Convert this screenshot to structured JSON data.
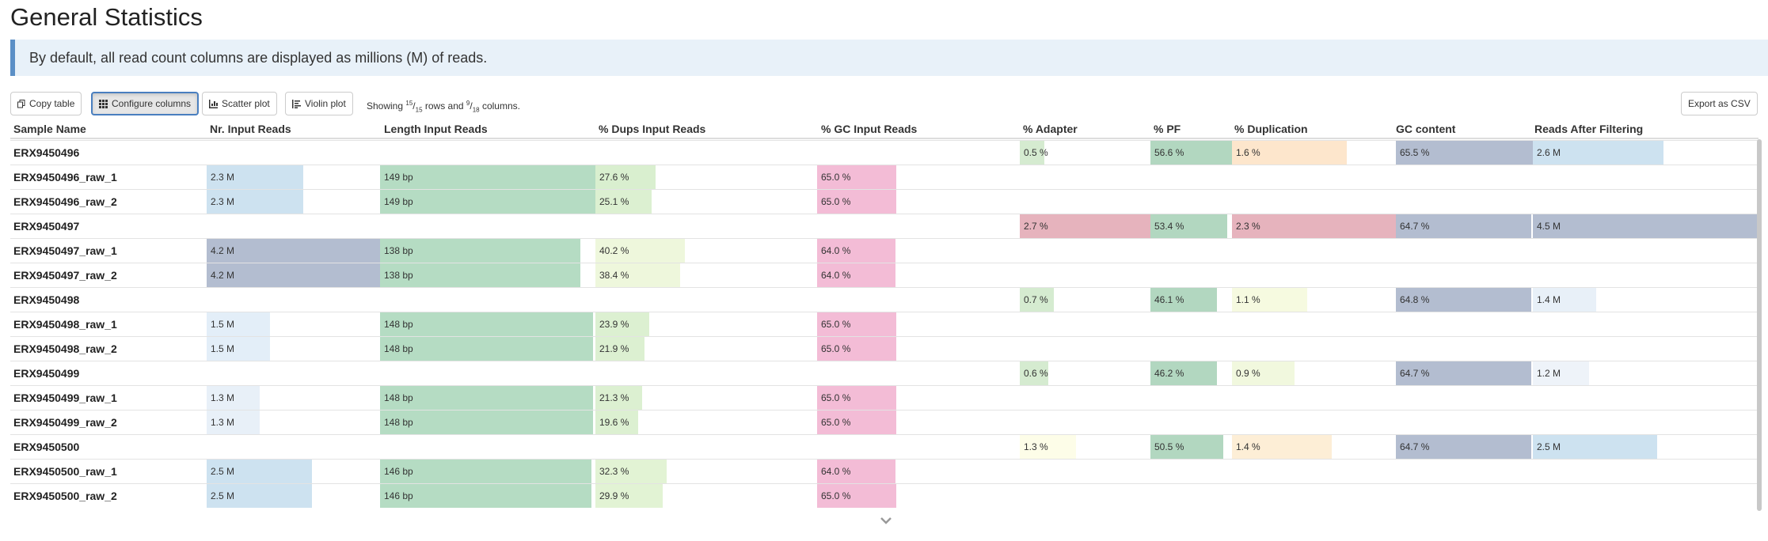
{
  "page": {
    "title": "General Statistics"
  },
  "banner": {
    "text": "By default, all read count columns are displayed as millions (M) of reads."
  },
  "toolbar": {
    "copy_label": "Copy table",
    "configure_label": "Configure columns",
    "scatter_label": "Scatter plot",
    "violin_label": "Violin plot",
    "showing_prefix": "Showing",
    "rows_shown": "15",
    "rows_total": "15",
    "rows_word": "rows and",
    "cols_shown": "9",
    "cols_total": "18",
    "cols_word": "columns.",
    "export_label": "Export as CSV"
  },
  "columns": [
    {
      "key": "sample",
      "label": "Sample Name"
    },
    {
      "key": "nr",
      "label": "Nr. Input Reads",
      "color": "#cde2f0",
      "max": 4.2
    },
    {
      "key": "len",
      "label": "Length Input Reads",
      "color": "#b5dcc3",
      "max": 149
    },
    {
      "key": "dups",
      "label": "% Dups Input Reads",
      "color": "#e2f2d2",
      "max": 40.2
    },
    {
      "key": "gc",
      "label": "% GC Input Reads",
      "color": "#f3bcd6",
      "max": 65.0
    },
    {
      "key": "adapter",
      "label": "% Adapter",
      "color": "#d5ebd0",
      "max": 2.7
    },
    {
      "key": "pf",
      "label": "% PF",
      "color": "#b2d7c0",
      "max": 56.6
    },
    {
      "key": "duplication",
      "label": "% Duplication",
      "color": "#fde6cc",
      "max": 2.3
    },
    {
      "key": "gccontent",
      "label": "GC content",
      "color": "#b3bdd0",
      "max": 65.5
    },
    {
      "key": "reads_after",
      "label": "Reads After Filtering",
      "color": "#cde2f0",
      "max": 4.5
    }
  ],
  "rows": [
    {
      "sample": "ERX9450496",
      "adapter": {
        "text": "0.5 %",
        "frac": 0.19
      },
      "pf": {
        "text": "56.6 %",
        "frac": 1.0
      },
      "duplication": {
        "text": "1.6 %",
        "frac": 0.7,
        "color": "#fde6cc"
      },
      "gccontent": {
        "text": "65.5 %",
        "frac": 1.0
      },
      "reads_after": {
        "text": "2.6 M",
        "frac": 0.58,
        "color": "#cde2f0"
      }
    },
    {
      "sample": "ERX9450496_raw_1",
      "nr": {
        "text": "2.3 M",
        "frac": 0.55,
        "color": "#cde2f0"
      },
      "len": {
        "text": "149 bp",
        "frac": 1.0
      },
      "dups": {
        "text": "27.6 %",
        "frac": 0.27,
        "color": "#d9efcf"
      },
      "gc": {
        "text": "65.0 %",
        "frac": 0.6
      }
    },
    {
      "sample": "ERX9450496_raw_2",
      "nr": {
        "text": "2.3 M",
        "frac": 0.55,
        "color": "#cde2f0"
      },
      "len": {
        "text": "149 bp",
        "frac": 1.0
      },
      "dups": {
        "text": "25.1 %",
        "frac": 0.25,
        "color": "#dcf0d1"
      },
      "gc": {
        "text": "65.0 %",
        "frac": 0.6
      }
    },
    {
      "sample": "ERX9450497",
      "adapter": {
        "text": "2.7 %",
        "frac": 1.0,
        "color": "#e6b3bd"
      },
      "pf": {
        "text": "53.4 %",
        "frac": 0.94
      },
      "duplication": {
        "text": "2.3 %",
        "frac": 1.0,
        "color": "#e6b3bd"
      },
      "gccontent": {
        "text": "64.7 %",
        "frac": 0.99
      },
      "reads_after": {
        "text": "4.5 M",
        "frac": 1.0,
        "color": "#b3bdd0"
      }
    },
    {
      "sample": "ERX9450497_raw_1",
      "nr": {
        "text": "4.2 M",
        "frac": 1.0,
        "color": "#b3bdd0"
      },
      "len": {
        "text": "138 bp",
        "frac": 0.93
      },
      "dups": {
        "text": "40.2 %",
        "frac": 0.4,
        "color": "#eef7dc"
      },
      "gc": {
        "text": "64.0 %",
        "frac": 0.59
      }
    },
    {
      "sample": "ERX9450497_raw_2",
      "nr": {
        "text": "4.2 M",
        "frac": 1.0,
        "color": "#b3bdd0"
      },
      "len": {
        "text": "138 bp",
        "frac": 0.93
      },
      "dups": {
        "text": "38.4 %",
        "frac": 0.38,
        "color": "#eef7dc"
      },
      "gc": {
        "text": "64.0 %",
        "frac": 0.59
      }
    },
    {
      "sample": "ERX9450498",
      "adapter": {
        "text": "0.7 %",
        "frac": 0.26
      },
      "pf": {
        "text": "46.1 %",
        "frac": 0.82
      },
      "duplication": {
        "text": "1.1 %",
        "frac": 0.46,
        "color": "#f6fae0"
      },
      "gccontent": {
        "text": "64.8 %",
        "frac": 0.99
      },
      "reads_after": {
        "text": "1.4 M",
        "frac": 0.28,
        "color": "#e8f0f8"
      }
    },
    {
      "sample": "ERX9450498_raw_1",
      "nr": {
        "text": "1.5 M",
        "frac": 0.36,
        "color": "#e3eef8"
      },
      "len": {
        "text": "148 bp",
        "frac": 0.99
      },
      "dups": {
        "text": "23.9 %",
        "frac": 0.24,
        "color": "#dcf0d1"
      },
      "gc": {
        "text": "65.0 %",
        "frac": 0.6
      }
    },
    {
      "sample": "ERX9450498_raw_2",
      "nr": {
        "text": "1.5 M",
        "frac": 0.36,
        "color": "#e3eef8"
      },
      "len": {
        "text": "148 bp",
        "frac": 0.99
      },
      "dups": {
        "text": "21.9 %",
        "frac": 0.22,
        "color": "#dcf0d1"
      },
      "gc": {
        "text": "65.0 %",
        "frac": 0.6
      }
    },
    {
      "sample": "ERX9450499",
      "adapter": {
        "text": "0.6 %",
        "frac": 0.22
      },
      "pf": {
        "text": "46.2 %",
        "frac": 0.82
      },
      "duplication": {
        "text": "0.9 %",
        "frac": 0.38,
        "color": "#f1f8de"
      },
      "gccontent": {
        "text": "64.7 %",
        "frac": 0.99
      },
      "reads_after": {
        "text": "1.2 M",
        "frac": 0.25,
        "color": "#eef3f9"
      }
    },
    {
      "sample": "ERX9450499_raw_1",
      "nr": {
        "text": "1.3 M",
        "frac": 0.3,
        "color": "#e8f0f8"
      },
      "len": {
        "text": "148 bp",
        "frac": 0.99
      },
      "dups": {
        "text": "21.3 %",
        "frac": 0.21,
        "color": "#dcf0d1"
      },
      "gc": {
        "text": "65.0 %",
        "frac": 0.6
      }
    },
    {
      "sample": "ERX9450499_raw_2",
      "nr": {
        "text": "1.3 M",
        "frac": 0.3,
        "color": "#e8f0f8"
      },
      "len": {
        "text": "148 bp",
        "frac": 0.99
      },
      "dups": {
        "text": "19.6 %",
        "frac": 0.19,
        "color": "#dcf0d1"
      },
      "gc": {
        "text": "65.0 %",
        "frac": 0.6
      }
    },
    {
      "sample": "ERX9450500",
      "adapter": {
        "text": "1.3 %",
        "frac": 0.43,
        "color": "#fdfde8"
      },
      "pf": {
        "text": "50.5 %",
        "frac": 0.89
      },
      "duplication": {
        "text": "1.4 %",
        "frac": 0.61,
        "color": "#fdeed6"
      },
      "gccontent": {
        "text": "64.7 %",
        "frac": 0.99
      },
      "reads_after": {
        "text": "2.5 M",
        "frac": 0.55,
        "color": "#cde2f0"
      }
    },
    {
      "sample": "ERX9450500_raw_1",
      "nr": {
        "text": "2.5 M",
        "frac": 0.6,
        "color": "#cde2f0"
      },
      "len": {
        "text": "146 bp",
        "frac": 0.98
      },
      "dups": {
        "text": "32.3 %",
        "frac": 0.32,
        "color": "#e2f3d4"
      },
      "gc": {
        "text": "64.0 %",
        "frac": 0.59
      }
    },
    {
      "sample": "ERX9450500_raw_2",
      "nr": {
        "text": "2.5 M",
        "frac": 0.6,
        "color": "#cde2f0"
      },
      "len": {
        "text": "146 bp",
        "frac": 0.98
      },
      "dups": {
        "text": "29.9 %",
        "frac": 0.3,
        "color": "#e2f3d4"
      },
      "gc": {
        "text": "65.0 %",
        "frac": 0.6
      }
    }
  ],
  "icons": {
    "copy": "copy-icon",
    "configure": "grid-icon",
    "scatter": "scatter-icon",
    "violin": "violin-icon",
    "expand": "chevron-down-icon"
  }
}
